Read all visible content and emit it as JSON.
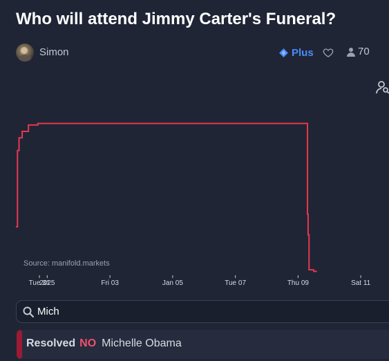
{
  "title": "Who will attend Jimmy Carter's Funeral?",
  "author": {
    "name": "Simon",
    "avatar_icon": "user-avatar"
  },
  "header": {
    "plus_label": "Plus",
    "plus_icon": "diamond-icon",
    "like_icon": "heart-icon",
    "trader_count": "70",
    "trader_icon": "person-icon",
    "stats_icon": "bar-chart-icon"
  },
  "chart_side_icon": "user-search-icon",
  "chart": {
    "source": "Source: manifold.markets"
  },
  "chart_data": {
    "type": "line",
    "series": [
      {
        "color": "#e8374f",
        "points": [
          [
            0.0,
            30
          ],
          [
            0.05,
            78
          ],
          [
            0.1,
            86
          ],
          [
            0.2,
            90
          ],
          [
            0.4,
            94
          ],
          [
            0.7,
            95
          ],
          [
            2.0,
            95
          ],
          [
            5.0,
            95
          ],
          [
            6.0,
            95
          ],
          [
            8.0,
            95
          ],
          [
            9.0,
            95
          ],
          [
            9.2,
            95
          ],
          [
            9.3,
            38
          ],
          [
            9.32,
            25
          ],
          [
            9.35,
            3
          ],
          [
            9.5,
            2
          ],
          [
            9.6,
            2
          ]
        ]
      }
    ],
    "x_ticks": [
      "Tue 31",
      "2025",
      "Fri 03",
      "Jan 05",
      "Tue 07",
      "Thu 09",
      "Sat 11"
    ],
    "x_tick_values": [
      0.75,
      1.0,
      3.0,
      5.0,
      7.0,
      9.0,
      11.0
    ],
    "xlim": [
      0.0,
      11.9
    ],
    "ylim": [
      0,
      100
    ],
    "grid": false
  },
  "search": {
    "value": "Mich",
    "icon": "search-icon"
  },
  "answers": [
    {
      "status": "Resolved",
      "resolution": "NO",
      "name": "Michelle Obama",
      "bar_color": "#9b1b34"
    }
  ],
  "colors": {
    "background": "#1f2535",
    "accent": "#4a8cf7",
    "line": "#e8374f",
    "no": "#f0506e"
  }
}
